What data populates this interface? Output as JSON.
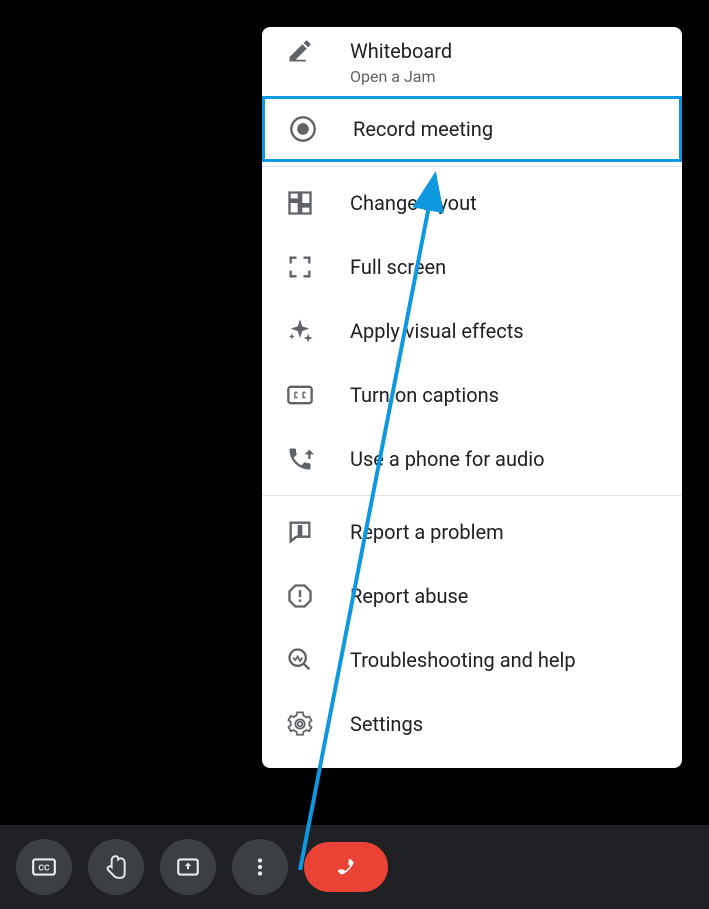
{
  "menu": {
    "groups": [
      [
        {
          "id": "whiteboard",
          "label": "Whiteboard",
          "sublabel": "Open a Jam",
          "icon": "pencil-icon"
        },
        {
          "id": "record",
          "label": "Record meeting",
          "icon": "record-icon",
          "highlighted": true
        }
      ],
      [
        {
          "id": "layout",
          "label": "Change layout",
          "icon": "layout-icon"
        },
        {
          "id": "fullscreen",
          "label": "Full screen",
          "icon": "fullscreen-icon"
        },
        {
          "id": "effects",
          "label": "Apply visual effects",
          "icon": "sparkle-icon"
        },
        {
          "id": "captions",
          "label": "Turn on captions",
          "icon": "cc-icon"
        },
        {
          "id": "phone",
          "label": "Use a phone for audio",
          "icon": "phone-forward-icon"
        }
      ],
      [
        {
          "id": "report-problem",
          "label": "Report a problem",
          "icon": "feedback-icon"
        },
        {
          "id": "report-abuse",
          "label": "Report abuse",
          "icon": "abuse-icon"
        },
        {
          "id": "troubleshoot",
          "label": "Troubleshooting and help",
          "icon": "troubleshoot-icon"
        },
        {
          "id": "settings",
          "label": "Settings",
          "icon": "gear-icon"
        }
      ]
    ]
  },
  "toolbar": {
    "buttons": [
      "captions",
      "raise-hand",
      "present",
      "more",
      "end-call"
    ]
  },
  "annotation": {
    "highlight_color": "#0d98e0"
  }
}
